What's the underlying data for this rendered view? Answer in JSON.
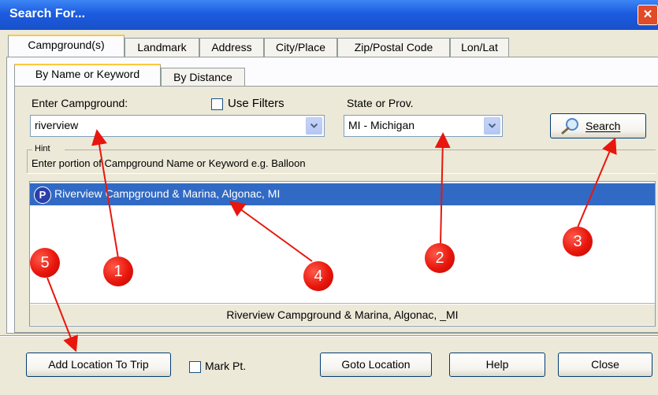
{
  "window": {
    "title": "Search For...",
    "close_glyph": "✕"
  },
  "tabs": [
    "Campground(s)",
    "Landmark",
    "Address",
    "City/Place",
    "Zip/Postal Code",
    "Lon/Lat"
  ],
  "sub_tabs": [
    "By Name or Keyword",
    "By Distance"
  ],
  "search": {
    "campground_label": "Enter Campground:",
    "campground_value": "riverview",
    "use_filters_label": "Use Filters",
    "state_label": "State or Prov.",
    "state_value": "MI - Michigan",
    "search_button": "Search",
    "search_icon": "magnifier-icon"
  },
  "hint": {
    "title": "Hint",
    "text": "Enter portion of Campground Name or  Keyword e.g. Balloon"
  },
  "results": {
    "items": [
      {
        "badge": "P",
        "label": "Riverview Campground & Marina, Algonac, MI"
      }
    ],
    "status": "Riverview Campground & Marina, Algonac, _MI"
  },
  "footer": {
    "add_button": "Add Location To Trip",
    "mark_pt_label": "Mark Pt.",
    "goto_button": "Goto Location",
    "help_button": "Help",
    "close_button": "Close"
  },
  "annotations": [
    "1",
    "2",
    "3",
    "4",
    "5"
  ],
  "colors": {
    "title_bar": "#1C5CE0",
    "selection": "#316AC5",
    "marker": "#E8160C"
  }
}
